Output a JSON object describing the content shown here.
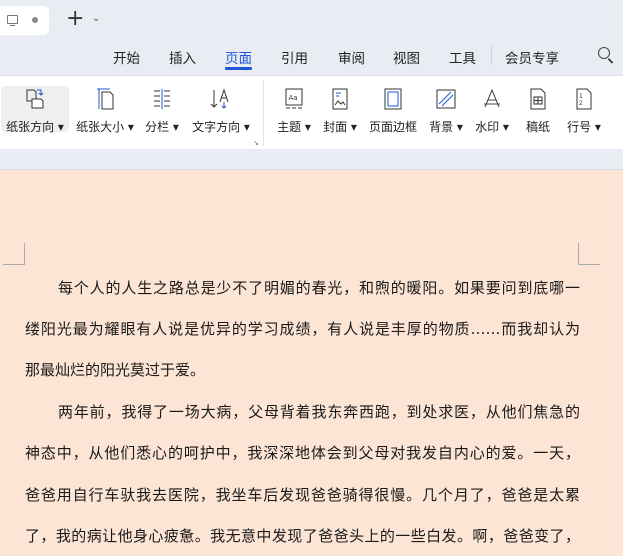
{
  "titlebar": {
    "new_tab": "+",
    "chevron": "⌄"
  },
  "tabs": [
    "开始",
    "插入",
    "页面",
    "引用",
    "审阅",
    "视图",
    "工具",
    "会员专享"
  ],
  "active_tab": "页面",
  "ribbon": [
    {
      "label": "纸张方向",
      "icon": "page-orientation-icon",
      "dropdown": true
    },
    {
      "label": "纸张大小",
      "icon": "page-size-icon",
      "dropdown": true
    },
    {
      "label": "分栏",
      "icon": "columns-icon",
      "dropdown": true
    },
    {
      "label": "文字方向",
      "icon": "text-direction-icon",
      "dropdown": true
    },
    {
      "label": "主题",
      "icon": "theme-icon",
      "dropdown": true
    },
    {
      "label": "封面",
      "icon": "cover-icon",
      "dropdown": true
    },
    {
      "label": "页面边框",
      "icon": "page-border-icon",
      "dropdown": false
    },
    {
      "label": "背景",
      "icon": "background-icon",
      "dropdown": true
    },
    {
      "label": "水印",
      "icon": "watermark-icon",
      "dropdown": true
    },
    {
      "label": "稿纸",
      "icon": "manuscript-icon",
      "dropdown": false
    },
    {
      "label": "行号",
      "icon": "line-number-icon",
      "dropdown": true
    }
  ],
  "document": {
    "lines": [
      "每个人的人生之路总是少不了明媚的春光，和煦的暖阳。如果要问到底哪一",
      "缕阳光最为耀眼有人说是优异的学习成绩，有人说是丰厚的物质……而我却认为",
      "那最灿烂的阳光莫过于爱。",
      "两年前，我得了一场大病，父母背着我东奔西跑，到处求医，从他们焦急的",
      "神态中，从他们悉心的呵护中，我深深地体会到父母对我发自内心的爱。一天，",
      "爸爸用自行车驮我去医院，我坐车后发现爸爸骑得很慢。几个月了，爸爸是太累",
      "了，我的病让他身心疲惫。我无意中发现了爸爸头上的一些白发。啊，爸爸变了，"
    ]
  },
  "colors": {
    "accent": "#2256d8",
    "page_bg": "#fce5d5"
  }
}
